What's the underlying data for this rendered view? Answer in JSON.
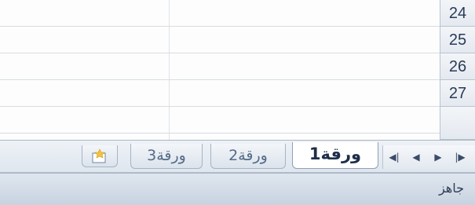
{
  "grid": {
    "rows": [
      "24",
      "25",
      "26",
      "27"
    ]
  },
  "sheet_tabs": {
    "active": "ورقة1",
    "inactive": [
      "ورقة2",
      "ورقة3"
    ],
    "new_sheet_icon": "insert-worksheet-icon"
  },
  "navigation": {
    "first": "first-sheet-icon",
    "prev": "previous-sheet-icon",
    "next": "next-sheet-icon",
    "last": "last-sheet-icon"
  },
  "status_bar": {
    "status": "جاهز"
  },
  "colors": {
    "tab_bar": "#e6ecf3",
    "status_bar": "#d2dce8",
    "row_header_text": "#2a3b58",
    "accent_arrow": "#e07a1f"
  }
}
